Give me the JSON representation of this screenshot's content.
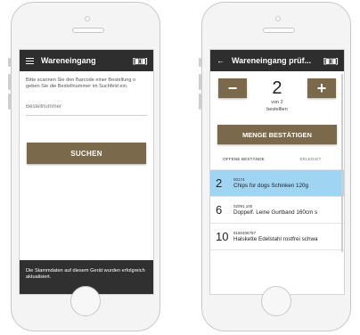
{
  "screen1": {
    "title": "Wareneingang",
    "instruction": "Bitte scannen Sie den Barcode einer Bestellung o geben Sie die Bestellnummer im Suchfeld ein.",
    "order_field": {
      "placeholder": "Bestellnummer",
      "value": ""
    },
    "search_label": "SUCHEN",
    "snackbar": "Die Stammdaten auf diesem Gerät wurden erfolgreich aktualisiert."
  },
  "screen2": {
    "title": "Wareneingang prüf...",
    "quantity": "2",
    "minus": "−",
    "plus": "+",
    "of_text": "von 2",
    "ordered_text": "bestellten",
    "confirm_label": "MENGE BESTÄTIGEN",
    "tabs": [
      "OFFENE BESTÄNDE",
      "ERLEDIGT"
    ],
    "items": [
      {
        "qty": "2",
        "code": "00174",
        "name": "Chips for dogs Schinken 120g"
      },
      {
        "qty": "6",
        "code": "02091.100",
        "name": "Doppelf. Leine Gurtband 160cm s"
      },
      {
        "qty": "10",
        "code": "5160406757",
        "name": "Halskette Edelstahl rostfrei schwa"
      }
    ]
  },
  "icons": {
    "menu": "menu-icon",
    "back": "back-arrow-icon",
    "barcode": "barcode-icon"
  },
  "colors": {
    "accent": "#7a6a4b",
    "topbar": "#2e2e2e",
    "selected_row": "#9fd4f3"
  }
}
